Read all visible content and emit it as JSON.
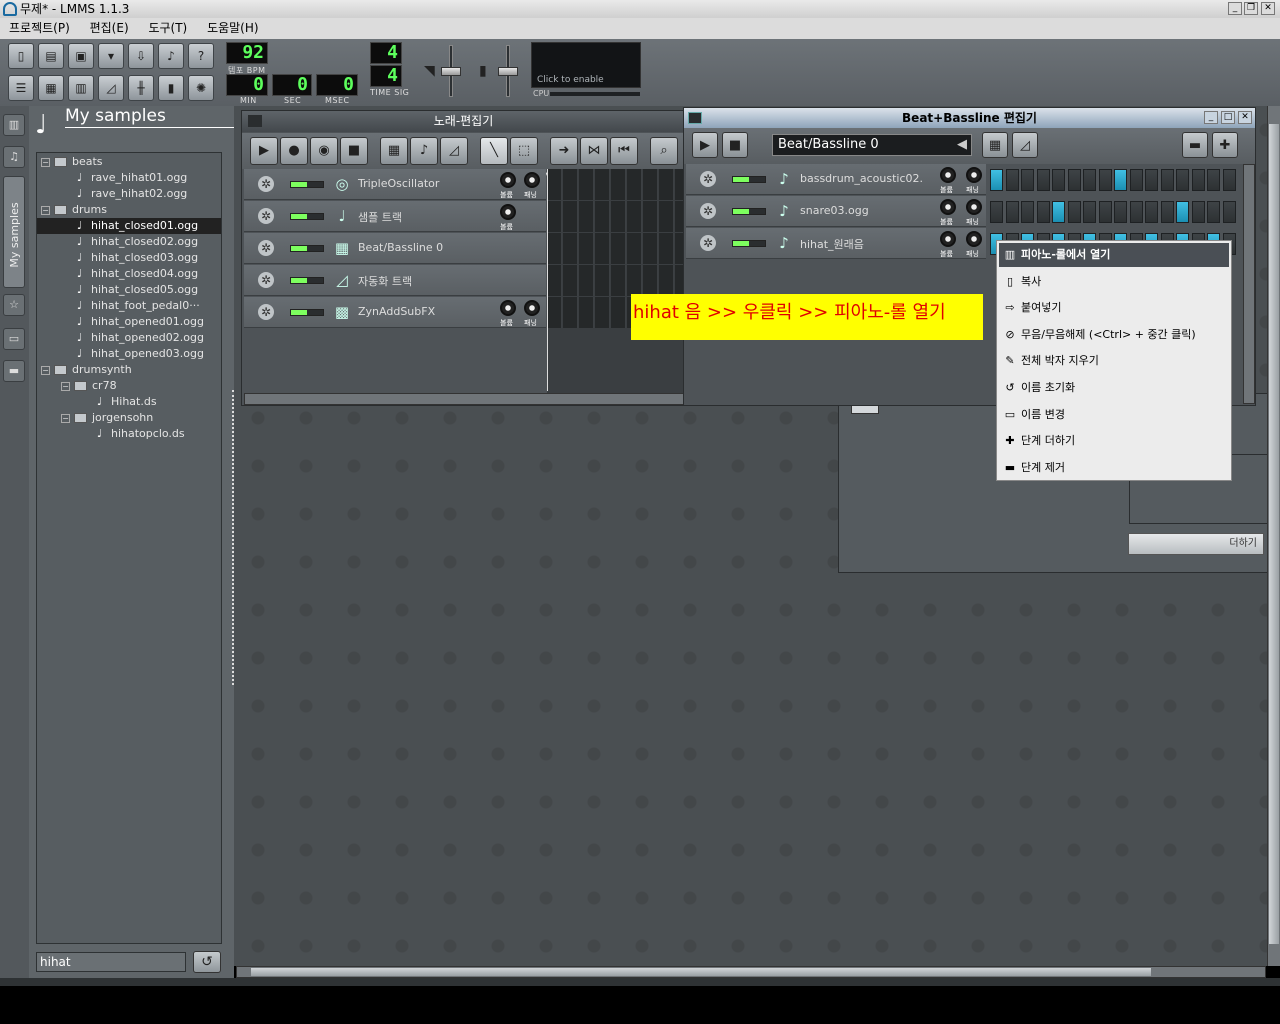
{
  "window": {
    "title": "무제* - LMMS 1.1.3"
  },
  "menu": [
    "프로젝트(P)",
    "편집(E)",
    "도구(T)",
    "도움말(H)"
  ],
  "transport": {
    "tempo": "92",
    "tempo_label": "템포 BPM",
    "min": "0",
    "sec": "0",
    "msec": "0",
    "min_label": "MIN",
    "sec_label": "SEC",
    "msec_label": "MSEC",
    "timesig_num": "4",
    "timesig_den": "4",
    "timesig_label": "TIME SIG",
    "cpu_hint": "Click to enable",
    "cpu_label": "CPU"
  },
  "sidebar": {
    "my_samples_tab": "My samples"
  },
  "browser": {
    "title": "My samples",
    "search_value": "hihat",
    "tree": [
      {
        "label": "beats",
        "type": "folder",
        "depth": 0
      },
      {
        "label": "rave_hihat01.ogg",
        "type": "file",
        "depth": 1
      },
      {
        "label": "rave_hihat02.ogg",
        "type": "file",
        "depth": 1
      },
      {
        "label": "drums",
        "type": "folder",
        "depth": 0
      },
      {
        "label": "hihat_closed01.ogg",
        "type": "file",
        "depth": 1,
        "selected": true
      },
      {
        "label": "hihat_closed02.ogg",
        "type": "file",
        "depth": 1
      },
      {
        "label": "hihat_closed03.ogg",
        "type": "file",
        "depth": 1
      },
      {
        "label": "hihat_closed04.ogg",
        "type": "file",
        "depth": 1
      },
      {
        "label": "hihat_closed05.ogg",
        "type": "file",
        "depth": 1
      },
      {
        "label": "hihat_foot_pedal0···",
        "type": "file",
        "depth": 1
      },
      {
        "label": "hihat_opened01.ogg",
        "type": "file",
        "depth": 1
      },
      {
        "label": "hihat_opened02.ogg",
        "type": "file",
        "depth": 1
      },
      {
        "label": "hihat_opened03.ogg",
        "type": "file",
        "depth": 1
      },
      {
        "label": "drumsynth",
        "type": "folder",
        "depth": 0
      },
      {
        "label": "cr78",
        "type": "folder",
        "depth": 1
      },
      {
        "label": "Hihat.ds",
        "type": "file",
        "depth": 2
      },
      {
        "label": "jorgensohn",
        "type": "folder",
        "depth": 1
      },
      {
        "label": "hihatopclo.ds",
        "type": "file",
        "depth": 2
      }
    ]
  },
  "song_editor": {
    "title": "노래-편집기",
    "tracks": [
      {
        "name": "TripleOscillator",
        "icon": "triple-oscillator-icon",
        "knobs": [
          "볼륨",
          "패닝"
        ]
      },
      {
        "name": "샘플 트랙",
        "icon": "sample-track-icon",
        "knobs": [
          "볼륨"
        ]
      },
      {
        "name": "Beat/Bassline 0",
        "icon": "beat-bassline-icon",
        "knobs": []
      },
      {
        "name": "자동화 트랙",
        "icon": "automation-icon",
        "knobs": []
      },
      {
        "name": "ZynAddSubFX",
        "icon": "zyn-icon",
        "knobs": [
          "볼륨",
          "패닝"
        ]
      }
    ]
  },
  "bb_editor": {
    "title": "Beat+Bassline 편집기",
    "pattern": "Beat/Bassline 0",
    "tracks": [
      {
        "name": "bassdrum_acoustic02.",
        "steps": [
          1,
          0,
          0,
          0,
          0,
          0,
          0,
          0,
          1,
          0,
          0,
          0,
          0,
          0,
          0,
          0
        ]
      },
      {
        "name": "snare03.ogg",
        "steps": [
          0,
          0,
          0,
          0,
          1,
          0,
          0,
          0,
          0,
          0,
          0,
          0,
          1,
          0,
          0,
          0
        ]
      },
      {
        "name": "hihat_원래음",
        "steps": [
          1,
          0,
          1,
          0,
          1,
          0,
          1,
          0,
          1,
          0,
          1,
          0,
          1,
          0,
          1,
          0
        ]
      }
    ],
    "knob_labels": [
      "볼륨",
      "패닝"
    ]
  },
  "context_menu": {
    "items": [
      {
        "label": "피아노-롤에서 열기",
        "icon": "piano-icon",
        "highlighted": true
      },
      {
        "label": "복사",
        "icon": "copy-icon"
      },
      {
        "label": "붙여넣기",
        "icon": "paste-icon"
      },
      {
        "label": "무음/무음해제 (<Ctrl> + 중간 클릭)",
        "icon": "mute-icon"
      },
      {
        "label": "전체 박자 지우기",
        "icon": "clear-icon"
      },
      {
        "label": "이름 초기화",
        "icon": "reset-icon"
      },
      {
        "label": "이름 변경",
        "icon": "rename-icon"
      },
      {
        "label": "단계 더하기",
        "icon": "add-step-icon"
      },
      {
        "label": "단계 제거",
        "icon": "remove-step-icon"
      }
    ]
  },
  "annotation": "hihat 음 >> 우클릭 >> 피아노-롤 열기",
  "add_button": "더하기"
}
